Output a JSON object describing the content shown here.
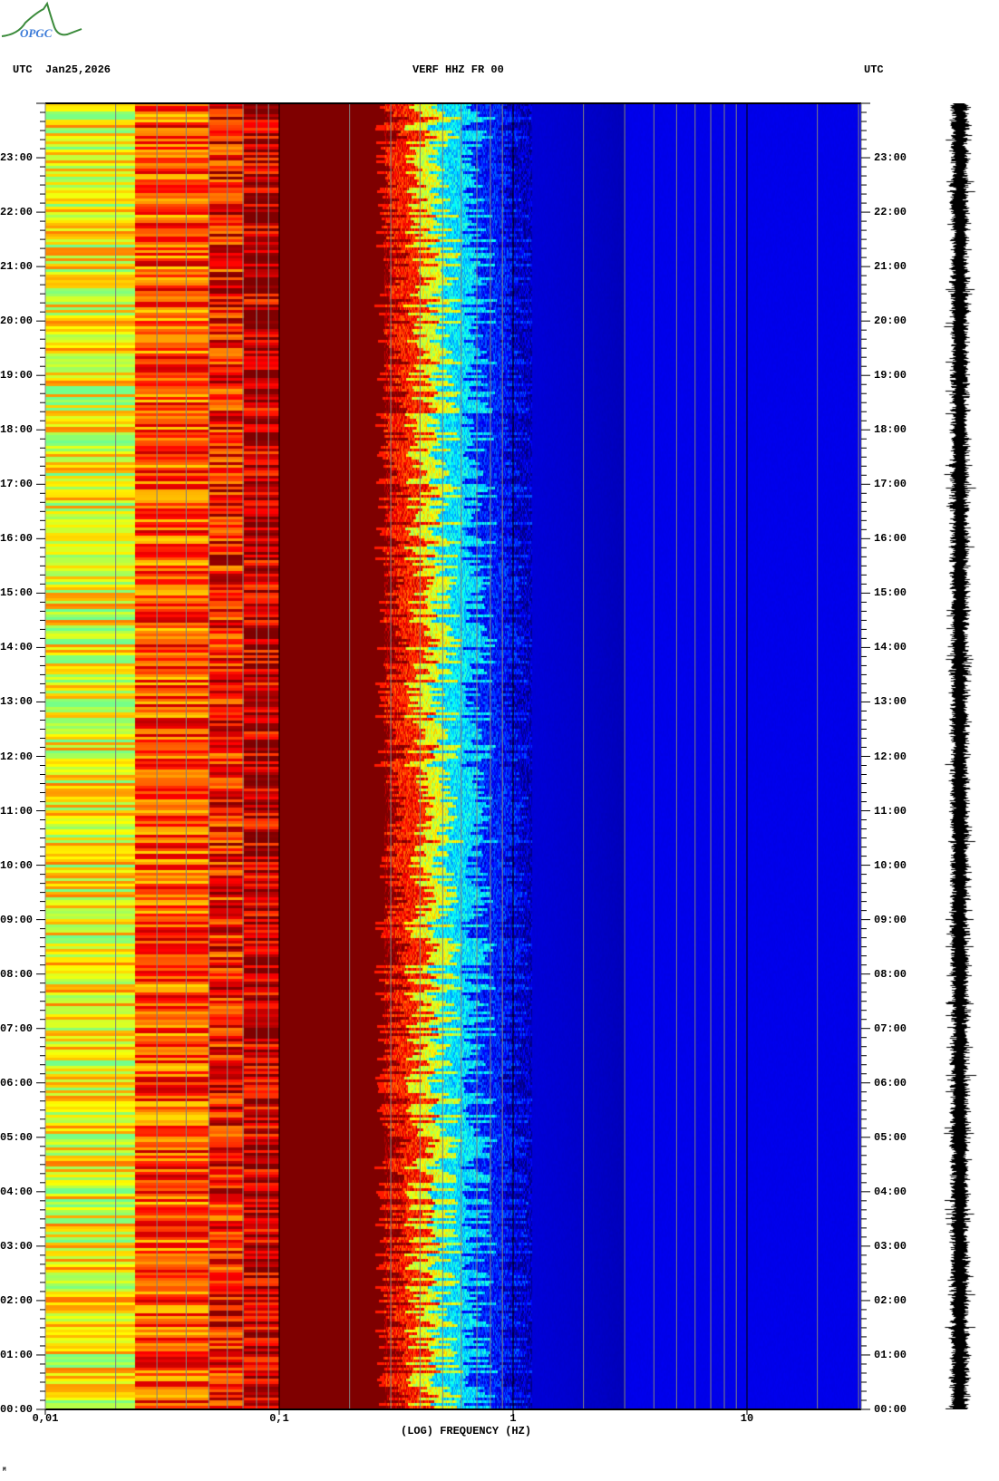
{
  "header": {
    "logo_text": "OPGC",
    "left_label": "UTC",
    "date": "Jan25,2026",
    "station": "VERF HHZ FR 00",
    "right_label": "UTC"
  },
  "footer_mark": "M",
  "colors": {
    "background": "#ffffff",
    "grid_minor": "#808080",
    "grid_decade": "#000000",
    "waveform": "#000000"
  },
  "chart_data": {
    "type": "heatmap",
    "title": "VERF HHZ FR 00",
    "date": "Jan25,2026",
    "xlabel": "(LOG) FREQUENCY (HZ)",
    "ylabel": "UTC",
    "xscale": "log",
    "xlim": [
      0.01,
      30
    ],
    "ylim_hours": [
      0,
      24
    ],
    "x_ticks": [
      {
        "value": 0.01,
        "label": "0,01"
      },
      {
        "value": 0.1,
        "label": "0,1"
      },
      {
        "value": 1,
        "label": "1"
      },
      {
        "value": 10,
        "label": "10"
      }
    ],
    "y_ticks": [
      "00:00",
      "01:00",
      "02:00",
      "03:00",
      "04:00",
      "05:00",
      "06:00",
      "07:00",
      "08:00",
      "09:00",
      "10:00",
      "11:00",
      "12:00",
      "13:00",
      "14:00",
      "15:00",
      "16:00",
      "17:00",
      "18:00",
      "19:00",
      "20:00",
      "21:00",
      "22:00",
      "23:00"
    ],
    "colormap": "jet",
    "band_profile": [
      {
        "from_hz": 0.01,
        "to_hz": 0.024,
        "level": 0.62
      },
      {
        "from_hz": 0.024,
        "to_hz": 0.05,
        "level": 0.8
      },
      {
        "from_hz": 0.05,
        "to_hz": 0.07,
        "level": 0.86
      },
      {
        "from_hz": 0.07,
        "to_hz": 0.1,
        "level": 0.93
      },
      {
        "from_hz": 0.1,
        "to_hz": 0.3,
        "level": 1.0
      },
      {
        "from_hz": 0.3,
        "to_hz": 0.4,
        "level": 0.85
      },
      {
        "from_hz": 0.4,
        "to_hz": 0.5,
        "level": 0.6
      },
      {
        "from_hz": 0.5,
        "to_hz": 0.7,
        "level": 0.35
      },
      {
        "from_hz": 0.7,
        "to_hz": 1.0,
        "level": 0.15
      },
      {
        "from_hz": 1.0,
        "to_hz": 30,
        "level": 0.06
      }
    ],
    "grid": true,
    "legend": "none",
    "side_trace": "seismogram, 24 h"
  }
}
